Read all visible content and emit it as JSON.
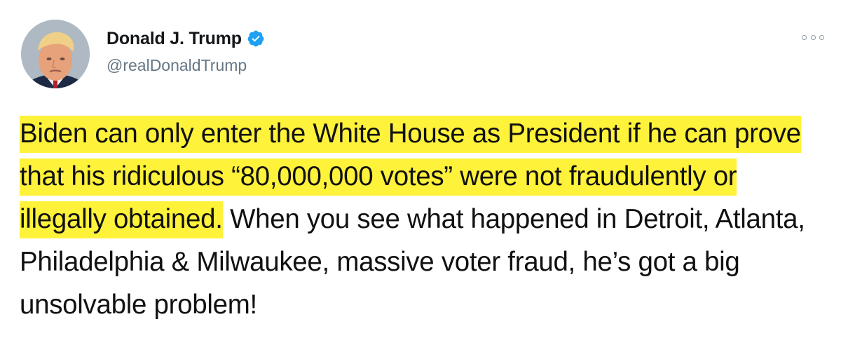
{
  "tweet": {
    "display_name": "Donald J. Trump",
    "handle": "@realDonaldTrump",
    "verified": true,
    "more_icon": "more-icon",
    "text_highlighted": "Biden can only enter the White House as President if he can prove that his ridiculous “80,000,000 votes” were not fraudulently or illegally obtained.",
    "text_rest": "When you see what happened in Detroit, Atlanta, Philadelphia & Milwaukee, massive voter fraud, he’s got a big unsolvable problem!",
    "colors": {
      "highlight": "#fff23a",
      "verified_badge": "#1da1f2",
      "handle": "#657786"
    }
  }
}
